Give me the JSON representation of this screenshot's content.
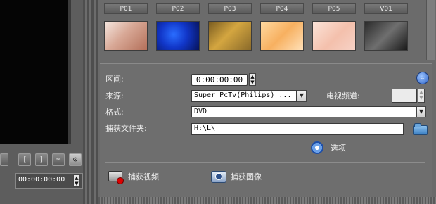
{
  "thumbnails": [
    {
      "label": "P01",
      "grad": "linear-gradient(135deg,#f5e6df,#d8a896 45%,#b4705a)"
    },
    {
      "label": "P02",
      "grad": "radial-gradient(circle at 40% 45%,#2a6dff,#1136c8 45%,#07135a)"
    },
    {
      "label": "P03",
      "grad": "linear-gradient(135deg,#7a5c20,#d4a640 45%,#8a6a2a)"
    },
    {
      "label": "P04",
      "grad": "linear-gradient(135deg,#ffd9a0,#f7b060 50%,#ffe0b8)"
    },
    {
      "label": "P05",
      "grad": "linear-gradient(135deg,#fbe3d8,#f4c0ac 55%,#f6d2c6)"
    },
    {
      "label": "V01",
      "grad": "linear-gradient(135deg,#2b2b2b,#6f6f6f 50%,#1a1a1a)"
    }
  ],
  "left": {
    "timecode": "00:00:00:00",
    "buttons": [
      "[",
      "]",
      "✂",
      "⊙"
    ]
  },
  "capture": {
    "duration_label": "区间:",
    "duration_value": "0:00:00:00",
    "source_label": "来源:",
    "source_value": "Super PcTv(Philips) ...",
    "tv_channel_label": "电视频道:",
    "tv_channel_value": "",
    "format_label": "格式:",
    "format_value": "DVD",
    "folder_label": "捕获文件夹:",
    "folder_value": "H:\\L\\",
    "options_label": "选项",
    "capture_video_label": "捕获视频",
    "capture_image_label": "捕获图像"
  }
}
